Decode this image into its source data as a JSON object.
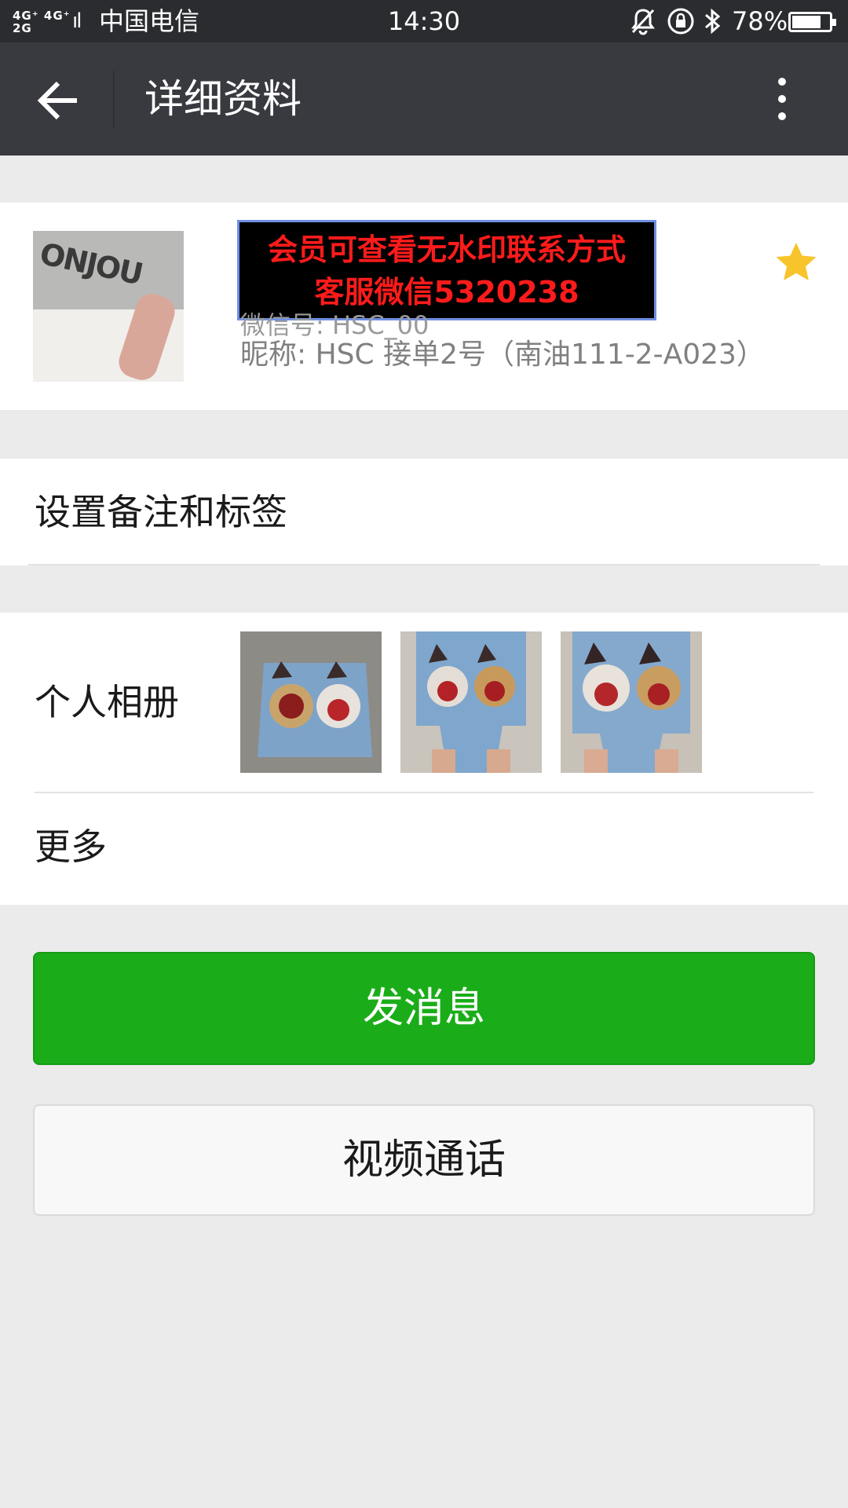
{
  "status_bar": {
    "network": "4G⁺ 4G⁺\n2G",
    "signal": "::ıl",
    "carrier": "中国电信",
    "time": "14:30",
    "battery": "78%",
    "battery_level": 0.78,
    "icons": [
      "bell-muted-icon",
      "lock-rotation-icon",
      "bluetooth-icon",
      "battery-icon"
    ]
  },
  "header": {
    "title": "详细资料",
    "back_icon": "arrow-left-icon",
    "menu_icon": "more-vertical-icon"
  },
  "profile": {
    "watermark_line1": "会员可查看无水印联系方式",
    "watermark_line2": "客服微信5320238",
    "wechat_id": "微信号: HSC_00",
    "nickname": "昵称: HSC 接单2号（南油111-2-A023）",
    "starred": true,
    "star_color": "#f7c42b"
  },
  "remark": {
    "label": "设置备注和标签"
  },
  "album": {
    "label": "个人相册",
    "photo_count": 3
  },
  "more": {
    "label": "更多"
  },
  "buttons": {
    "send_message": "发消息",
    "video_call": "视频通话"
  },
  "colors": {
    "primary_green": "#1aad19",
    "header_bg": "#393a3f",
    "status_bg": "#2b2c30",
    "page_bg": "#ebebeb"
  }
}
